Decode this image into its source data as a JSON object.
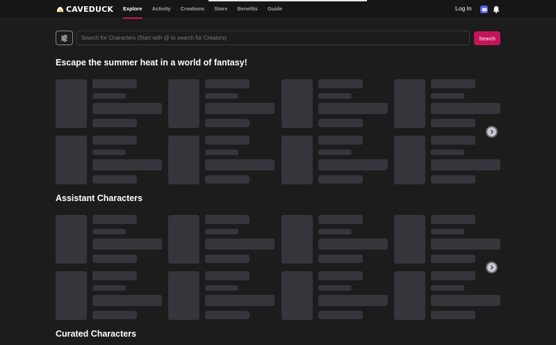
{
  "header": {
    "logo_text": "CAVEDUCK",
    "nav": [
      {
        "label": "Explore",
        "active": true
      },
      {
        "label": "Activity",
        "active": false
      },
      {
        "label": "Creations",
        "active": false
      },
      {
        "label": "Store",
        "active": false
      },
      {
        "label": "Benefits",
        "active": false
      },
      {
        "label": "Guide",
        "active": false
      }
    ],
    "login_label": "Log In",
    "icons": [
      "discord-icon",
      "bell-icon"
    ]
  },
  "search": {
    "placeholder": "Search for Characters (Start with @ to search for Creators)",
    "value": "",
    "button_label": "Search",
    "filter_icon": "sliders-icon"
  },
  "sections": [
    {
      "title": "Escape the summer heat in a world of fantasy!",
      "placeholder_cards": 8
    },
    {
      "title": "Assistant Characters",
      "placeholder_cards": 8
    },
    {
      "title": "Curated Characters",
      "placeholder_cards": 0
    }
  ],
  "colors": {
    "background": "#1c1c1c",
    "accent": "#d1135a",
    "button": "#c4155a",
    "skeleton": "#35353b",
    "discord": "#5865f2"
  }
}
